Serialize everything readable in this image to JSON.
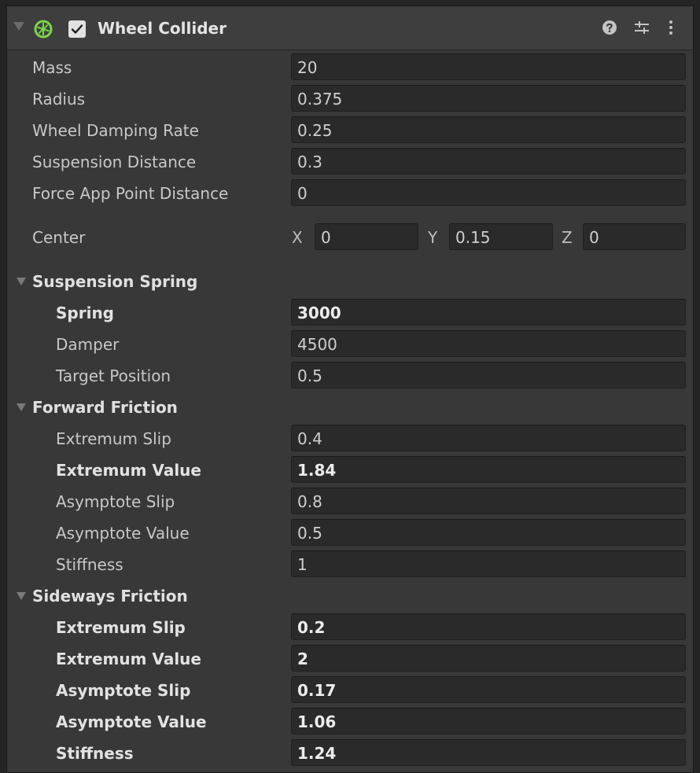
{
  "component": {
    "title": "Wheel Collider",
    "enabled": true,
    "icon": "wheel-collider-icon",
    "header_buttons": [
      "help-icon",
      "preset-icon",
      "more-options-icon"
    ]
  },
  "properties": [
    {
      "label": "Mass",
      "value": "20"
    },
    {
      "label": "Radius",
      "value": "0.375"
    },
    {
      "label": "Wheel Damping Rate",
      "value": "0.25"
    },
    {
      "label": "Suspension Distance",
      "value": "0.3"
    },
    {
      "label": "Force App Point Distance",
      "value": "0"
    }
  ],
  "center": {
    "label": "Center",
    "x_label": "X",
    "x": "0",
    "y_label": "Y",
    "y": "0.15",
    "z_label": "Z",
    "z": "0"
  },
  "suspension_spring": {
    "title": "Suspension Spring",
    "rows": [
      {
        "label": "Spring",
        "value": "3000",
        "overridden": true
      },
      {
        "label": "Damper",
        "value": "4500",
        "overridden": false
      },
      {
        "label": "Target Position",
        "value": "0.5",
        "overridden": false
      }
    ]
  },
  "forward_friction": {
    "title": "Forward Friction",
    "rows": [
      {
        "label": "Extremum Slip",
        "value": "0.4",
        "overridden": false
      },
      {
        "label": "Extremum Value",
        "value": "1.84",
        "overridden": true
      },
      {
        "label": "Asymptote Slip",
        "value": "0.8",
        "overridden": false
      },
      {
        "label": "Asymptote Value",
        "value": "0.5",
        "overridden": false
      },
      {
        "label": "Stiffness",
        "value": "1",
        "overridden": false
      }
    ]
  },
  "sideways_friction": {
    "title": "Sideways Friction",
    "rows": [
      {
        "label": "Extremum Slip",
        "value": "0.2",
        "overridden": true
      },
      {
        "label": "Extremum Value",
        "value": "2",
        "overridden": true
      },
      {
        "label": "Asymptote Slip",
        "value": "0.17",
        "overridden": true
      },
      {
        "label": "Asymptote Value",
        "value": "1.06",
        "overridden": true
      },
      {
        "label": "Stiffness",
        "value": "1.24",
        "overridden": true
      }
    ]
  },
  "colors": {
    "panel_background": "#383838",
    "header_background": "#3e3e3e",
    "field_background": "#2a2a2a",
    "icon_accent": "#7cd64a"
  }
}
